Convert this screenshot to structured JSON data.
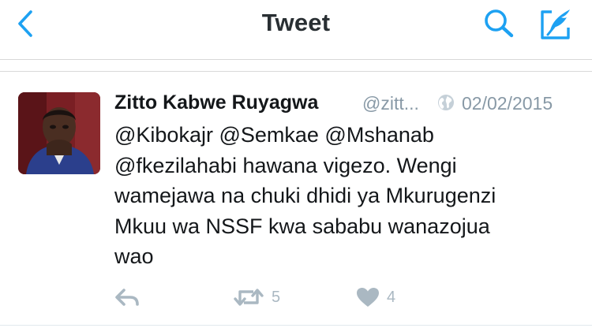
{
  "navbar": {
    "title": "Tweet",
    "icons": {
      "back": "back-chevron-icon",
      "search": "search-icon",
      "compose": "compose-tweet-icon"
    },
    "accent_color": "#1da1f2"
  },
  "tweet": {
    "author_name": "Zitto Kabwe Ruyagwa",
    "author_handle": "@zitt...",
    "date": "02/02/2015",
    "text_lines": [
      "@Kibokajr @Semkae @Mshanab",
      "@fkezilahabi hawana vigezo. Wengi",
      "wamejawa na chuki dhidi ya Mkurugenzi",
      "Mkuu wa NSSF kwa sababu wanazojua",
      "wao"
    ],
    "actions": {
      "reply_icon": "reply-icon",
      "retweet_icon": "retweet-icon",
      "retweet_count": "5",
      "like_icon": "heart-icon",
      "like_count": "4"
    },
    "icon_gray": "#aab8c2"
  }
}
